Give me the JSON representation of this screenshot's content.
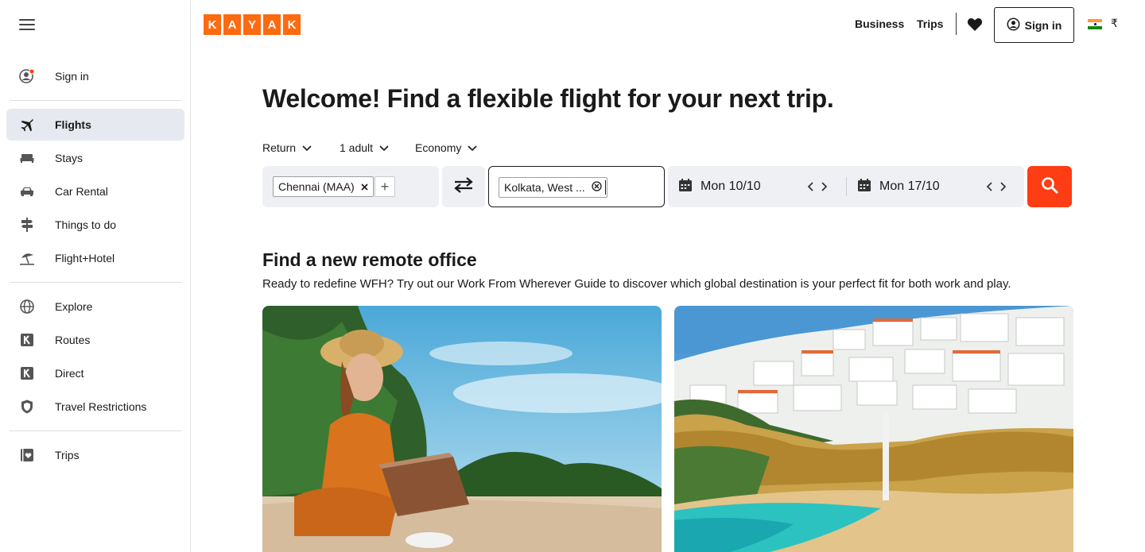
{
  "sidebar": {
    "menu_icon": "hamburger-icon",
    "items": [
      {
        "label": "Sign in",
        "icon": "user-circle-icon"
      },
      {
        "label": "Flights",
        "icon": "airplane-icon"
      },
      {
        "label": "Stays",
        "icon": "bed-icon"
      },
      {
        "label": "Car Rental",
        "icon": "car-icon"
      },
      {
        "label": "Things to do",
        "icon": "signpost-icon"
      },
      {
        "label": "Flight+Hotel",
        "icon": "beach-umbrella-icon"
      },
      {
        "label": "Explore",
        "icon": "globe-icon"
      },
      {
        "label": "Routes",
        "icon": "kayak-k-icon"
      },
      {
        "label": "Direct",
        "icon": "kayak-k-icon"
      },
      {
        "label": "Travel Restrictions",
        "icon": "shield-icon"
      },
      {
        "label": "Trips",
        "icon": "trips-heart-icon"
      }
    ],
    "active": "Flights"
  },
  "header": {
    "logo_letters": [
      "K",
      "A",
      "Y",
      "A",
      "K"
    ],
    "business": "Business",
    "trips": "Trips",
    "sign_in": "Sign in",
    "currency": "₹",
    "brand_color": "#ff690f"
  },
  "search": {
    "headline": "Welcome! Find a flexible flight for your next trip.",
    "trip_type": "Return",
    "travellers": "1 adult",
    "cabin": "Economy",
    "origin_chip": "Chennai (MAA)",
    "destination_chip": "Kolkata, West ...",
    "depart_date": "Mon 10/10",
    "return_date": "Mon 17/10",
    "search_color": "#ff3d14"
  },
  "section": {
    "title": "Find a new remote office",
    "subtitle": "Ready to redefine WFH? Try out our Work From Wherever Guide to discover which global destination is your perfect fit for both work and play."
  }
}
